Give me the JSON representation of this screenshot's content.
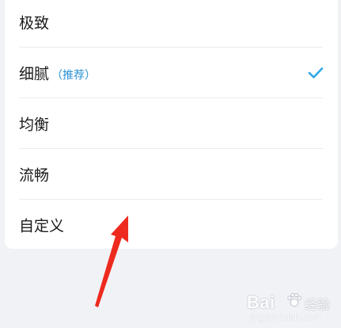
{
  "options": [
    {
      "label": "极致",
      "tag": "",
      "selected": false
    },
    {
      "label": "细腻",
      "tag": "（推荐）",
      "selected": true
    },
    {
      "label": "均衡",
      "tag": "",
      "selected": false
    },
    {
      "label": "流畅",
      "tag": "",
      "selected": false
    },
    {
      "label": "自定义",
      "tag": "",
      "selected": false
    }
  ],
  "icons": {
    "check": "checkmark-icon",
    "annotation": "red-arrow-icon"
  },
  "colors": {
    "check": "#2fa6e3",
    "tag": "#2a90d4",
    "arrow": "#ee2a1f",
    "background": "#f1f2f6"
  },
  "watermark": {
    "logo": "Bai",
    "logo_suffix": "经验",
    "url": "jingyan.baidu.com"
  }
}
